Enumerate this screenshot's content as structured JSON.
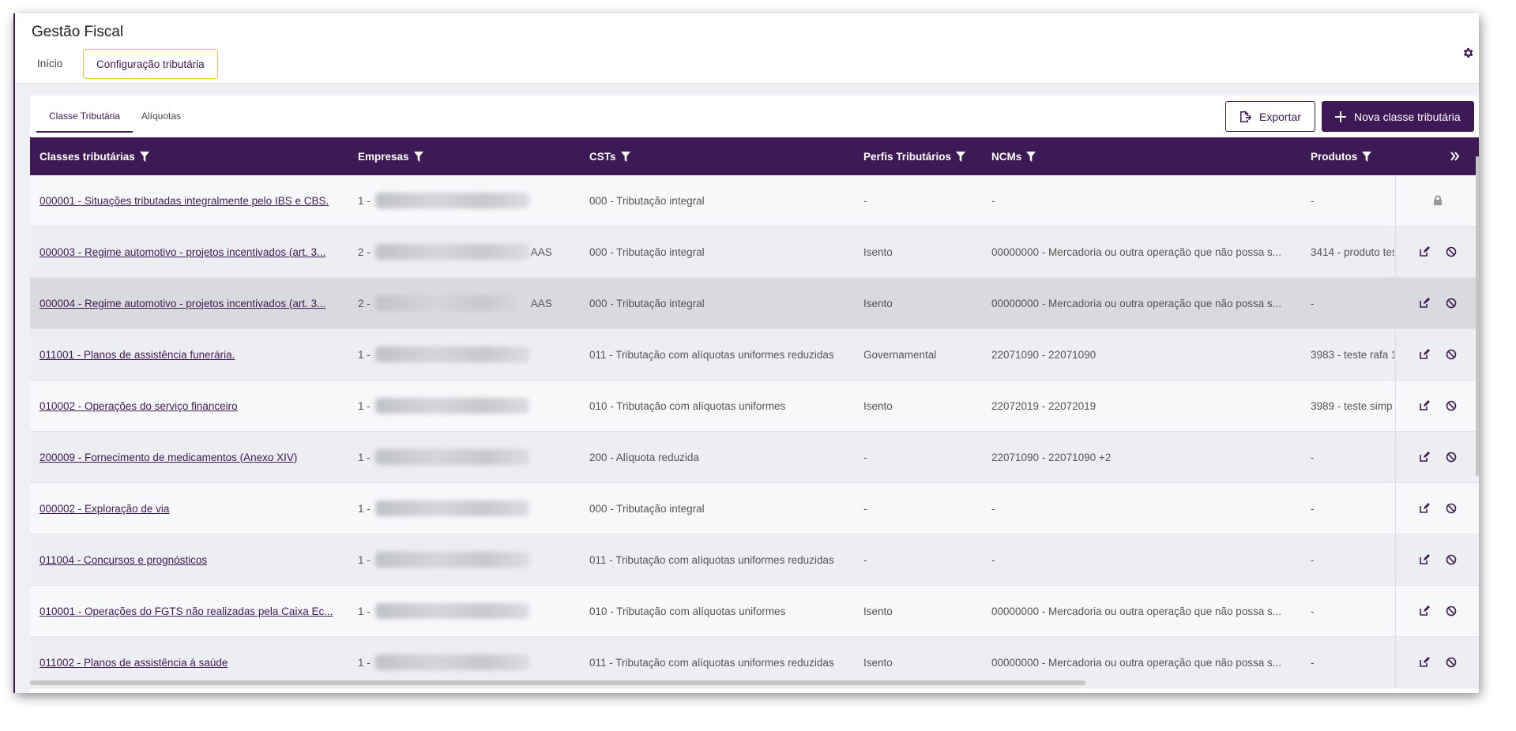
{
  "app": {
    "title": "Gestão Fiscal",
    "tabs": [
      {
        "label": "Início",
        "active": false
      },
      {
        "label": "Configuração tributária",
        "active": true
      }
    ],
    "settings_icon": "gear-icon"
  },
  "subtabs": [
    {
      "label": "Classe Tributária",
      "active": true
    },
    {
      "label": "Alíquotas",
      "active": false
    }
  ],
  "toolbar": {
    "export_label": "Exportar",
    "new_label": "Nova classe tributária"
  },
  "table": {
    "columns": [
      {
        "label": "Classes tributárias",
        "filter": true
      },
      {
        "label": "Empresas",
        "filter": true
      },
      {
        "label": "CSTs",
        "filter": true
      },
      {
        "label": "Perfis Tributários",
        "filter": true
      },
      {
        "label": "NCMs",
        "filter": true
      },
      {
        "label": "Produtos",
        "filter": true
      }
    ],
    "expand_icon": "double-chevron-right-icon",
    "rows": [
      {
        "classe": "000001 - Situações tributadas integralmente pelo IBS e CBS.",
        "empresas_prefix": "1 -",
        "empresas_suffix": "",
        "cst": "000 - Tributação integral",
        "perfil": "-",
        "ncm": "-",
        "produto": "-",
        "locked": true
      },
      {
        "classe": "000003 - Regime automotivo - projetos incentivados (art. 3...",
        "empresas_prefix": "2 -",
        "empresas_suffix": "AAS",
        "cst": "000 - Tributação integral",
        "perfil": "Isento",
        "ncm": "00000000 - Mercadoria ou outra operação que não possa s...",
        "produto": "3414 - produto tes",
        "locked": false
      },
      {
        "classe": "000004 - Regime automotivo - projetos incentivados (art. 3...",
        "empresas_prefix": "2 -",
        "empresas_suffix": "AAS",
        "cst": "000 - Tributação integral",
        "perfil": "Isento",
        "ncm": "00000000 - Mercadoria ou outra operação que não possa s...",
        "produto": "-",
        "locked": false
      },
      {
        "classe": "011001 - Planos de assistência funerária.",
        "empresas_prefix": "1 -",
        "empresas_suffix": "",
        "cst": "011 - Tributação com alíquotas uniformes reduzidas",
        "perfil": "Governamental",
        "ncm": "22071090 - 22071090",
        "produto": "3983 - teste rafa 1",
        "locked": false
      },
      {
        "classe": "010002 - Operações do serviço financeiro",
        "empresas_prefix": "1 -",
        "empresas_suffix": "",
        "cst": "010 - Tributação com alíquotas uniformes",
        "perfil": "Isento",
        "ncm": "22072019 - 22072019",
        "produto": "3989 - teste simp",
        "locked": false
      },
      {
        "classe": "200009 - Fornecimento de medicamentos (Anexo XIV)",
        "empresas_prefix": "1 -",
        "empresas_suffix": "",
        "cst": "200 - Alíquota reduzida",
        "perfil": "-",
        "ncm": "22071090 - 22071090 +2",
        "produto": "-",
        "locked": false
      },
      {
        "classe": "000002 - Exploração de via",
        "empresas_prefix": "1 -",
        "empresas_suffix": "",
        "cst": "000 - Tributação integral",
        "perfil": "-",
        "ncm": "-",
        "produto": "-",
        "locked": false
      },
      {
        "classe": "011004 - Concursos e prognósticos",
        "empresas_prefix": "1 -",
        "empresas_suffix": "",
        "cst": "011 - Tributação com alíquotas uniformes reduzidas",
        "perfil": "-",
        "ncm": "-",
        "produto": "-",
        "locked": false
      },
      {
        "classe": "010001 - Operações do FGTS não realizadas pela Caixa Ec...",
        "empresas_prefix": "1 -",
        "empresas_suffix": "",
        "cst": "010 - Tributação com alíquotas uniformes",
        "perfil": "Isento",
        "ncm": "00000000 - Mercadoria ou outra operação que não possa s...",
        "produto": "-",
        "locked": false
      },
      {
        "classe": "011002 - Planos de assistência à saúde",
        "empresas_prefix": "1 -",
        "empresas_suffix": "",
        "cst": "011 - Tributação com alíquotas uniformes reduzidas",
        "perfil": "Isento",
        "ncm": "00000000 - Mercadoria ou outra operação que não possa s...",
        "produto": "-",
        "locked": false
      }
    ]
  },
  "colors": {
    "primary": "#3d1a55",
    "tab_highlight": "#f4bf3a",
    "row_odd": "#f7f8fa",
    "row_even": "#eceef1",
    "row_hover": "#d9dadd"
  }
}
